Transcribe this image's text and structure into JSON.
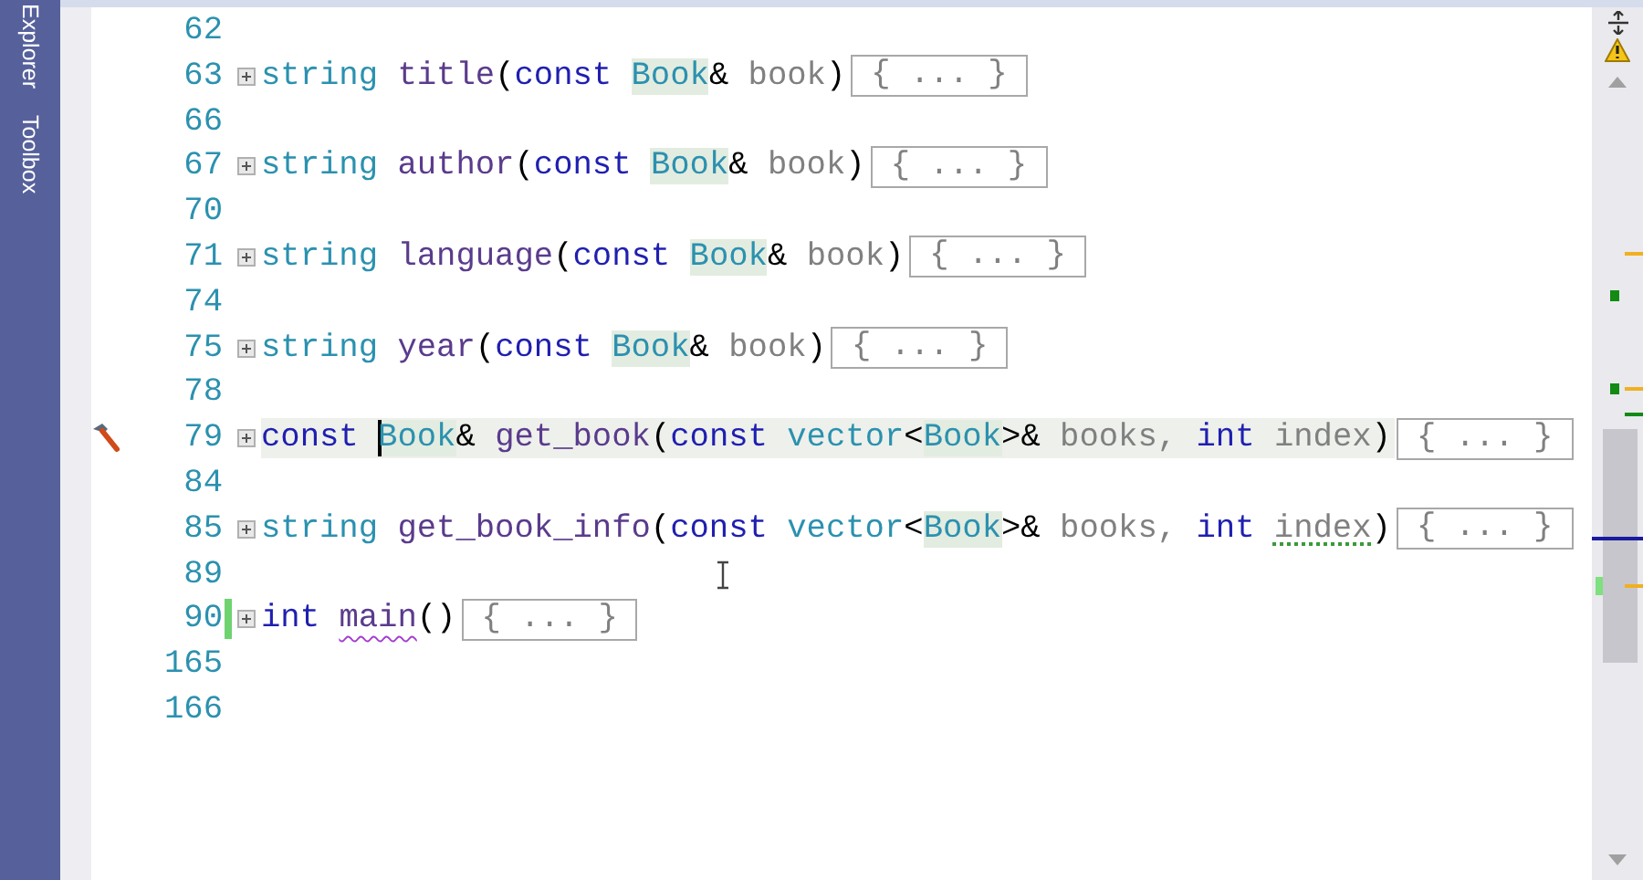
{
  "sidebar": {
    "tabs": [
      {
        "label": "Explorer",
        "selected": false
      },
      {
        "label": "Toolbox",
        "selected": false
      }
    ]
  },
  "editor": {
    "lines": [
      {
        "number": "62",
        "collapsible": false,
        "current": false,
        "changed": false,
        "quick_action": false
      },
      {
        "number": "63",
        "collapsible": true,
        "current": false,
        "changed": false,
        "quick_action": false,
        "tokens": [
          {
            "kind": "type",
            "text": "string"
          },
          {
            "kind": "func",
            "text": "title",
            "space_before": true
          },
          {
            "kind": "plain",
            "text": "("
          },
          {
            "kind": "keyword",
            "text": "const"
          },
          {
            "kind": "class",
            "text": "Book",
            "highlighted": true,
            "space_before": true
          },
          {
            "kind": "plain",
            "text": "&"
          },
          {
            "kind": "param",
            "text": "book",
            "space_before": true
          },
          {
            "kind": "plain",
            "text": ")"
          }
        ],
        "collapsed": "{ ... }"
      },
      {
        "number": "66",
        "collapsible": false,
        "current": false,
        "changed": false,
        "quick_action": false
      },
      {
        "number": "67",
        "collapsible": true,
        "current": false,
        "changed": false,
        "quick_action": false,
        "tokens": [
          {
            "kind": "type",
            "text": "string"
          },
          {
            "kind": "func",
            "text": "author",
            "space_before": true
          },
          {
            "kind": "plain",
            "text": "("
          },
          {
            "kind": "keyword",
            "text": "const"
          },
          {
            "kind": "class",
            "text": "Book",
            "highlighted": true,
            "space_before": true
          },
          {
            "kind": "plain",
            "text": "&"
          },
          {
            "kind": "param",
            "text": "book",
            "space_before": true
          },
          {
            "kind": "plain",
            "text": ")"
          }
        ],
        "collapsed": "{ ... }"
      },
      {
        "number": "70",
        "collapsible": false,
        "current": false,
        "changed": false,
        "quick_action": false
      },
      {
        "number": "71",
        "collapsible": true,
        "current": false,
        "changed": false,
        "quick_action": false,
        "tokens": [
          {
            "kind": "type",
            "text": "string"
          },
          {
            "kind": "func",
            "text": "language",
            "space_before": true
          },
          {
            "kind": "plain",
            "text": "("
          },
          {
            "kind": "keyword",
            "text": "const"
          },
          {
            "kind": "class",
            "text": "Book",
            "highlighted": true,
            "space_before": true
          },
          {
            "kind": "plain",
            "text": "&"
          },
          {
            "kind": "param",
            "text": "book",
            "space_before": true
          },
          {
            "kind": "plain",
            "text": ")"
          }
        ],
        "collapsed": "{ ... }"
      },
      {
        "number": "74",
        "collapsible": false,
        "current": false,
        "changed": false,
        "quick_action": false
      },
      {
        "number": "75",
        "collapsible": true,
        "current": false,
        "changed": false,
        "quick_action": false,
        "tokens": [
          {
            "kind": "type",
            "text": "string"
          },
          {
            "kind": "func",
            "text": "year",
            "space_before": true
          },
          {
            "kind": "plain",
            "text": "("
          },
          {
            "kind": "keyword",
            "text": "const"
          },
          {
            "kind": "class",
            "text": "Book",
            "highlighted": true,
            "space_before": true
          },
          {
            "kind": "plain",
            "text": "&"
          },
          {
            "kind": "param",
            "text": "book",
            "space_before": true
          },
          {
            "kind": "plain",
            "text": ")"
          }
        ],
        "collapsed": "{ ... }"
      },
      {
        "number": "78",
        "collapsible": false,
        "current": false,
        "changed": false,
        "quick_action": false
      },
      {
        "number": "79",
        "collapsible": true,
        "current": true,
        "changed": false,
        "quick_action": true,
        "tokens": [
          {
            "kind": "keyword",
            "text": "const"
          },
          {
            "kind": "class",
            "text": "Book",
            "highlighted": true,
            "caret": true,
            "space_before": true
          },
          {
            "kind": "plain",
            "text": "&"
          },
          {
            "kind": "func",
            "text": "get_book",
            "space_before": true
          },
          {
            "kind": "plain",
            "text": "("
          },
          {
            "kind": "keyword",
            "text": "const"
          },
          {
            "kind": "type",
            "text": "vector",
            "space_before": true
          },
          {
            "kind": "plain",
            "text": "<"
          },
          {
            "kind": "class",
            "text": "Book",
            "highlighted": true
          },
          {
            "kind": "plain",
            "text": ">&"
          },
          {
            "kind": "param",
            "text": "books,",
            "space_before": true
          },
          {
            "kind": "keyword",
            "text": "int",
            "space_before": true
          },
          {
            "kind": "param",
            "text": "index",
            "space_before": true
          },
          {
            "kind": "plain",
            "text": ")"
          }
        ],
        "collapsed": "{ ... }"
      },
      {
        "number": "84",
        "collapsible": false,
        "current": false,
        "changed": false,
        "quick_action": false
      },
      {
        "number": "85",
        "collapsible": true,
        "current": false,
        "changed": false,
        "quick_action": false,
        "tokens": [
          {
            "kind": "type",
            "text": "string"
          },
          {
            "kind": "func",
            "text": "get_book_info",
            "space_before": true
          },
          {
            "kind": "plain",
            "text": "("
          },
          {
            "kind": "keyword",
            "text": "const"
          },
          {
            "kind": "type",
            "text": "vector",
            "space_before": true
          },
          {
            "kind": "plain",
            "text": "<"
          },
          {
            "kind": "class",
            "text": "Book",
            "highlighted": true
          },
          {
            "kind": "plain",
            "text": ">&"
          },
          {
            "kind": "param",
            "text": "books,",
            "space_before": true
          },
          {
            "kind": "keyword",
            "text": "int",
            "space_before": true
          },
          {
            "kind": "param",
            "text": "index",
            "space_before": true,
            "hint_underline": true
          },
          {
            "kind": "plain",
            "text": ")"
          }
        ],
        "collapsed": "{ ... }"
      },
      {
        "number": "89",
        "collapsible": false,
        "current": false,
        "changed": false,
        "quick_action": false
      },
      {
        "number": "90",
        "collapsible": true,
        "current": false,
        "changed": true,
        "quick_action": false,
        "tokens": [
          {
            "kind": "keyword",
            "text": "int"
          },
          {
            "kind": "func",
            "text": "main",
            "space_before": true,
            "error_underline": true
          },
          {
            "kind": "plain",
            "text": "()"
          }
        ],
        "collapsed": "{ ... }"
      },
      {
        "number": "165",
        "collapsible": false,
        "current": false,
        "changed": false,
        "quick_action": false
      },
      {
        "number": "166",
        "collapsible": false,
        "current": false,
        "changed": false,
        "quick_action": false
      }
    ]
  }
}
